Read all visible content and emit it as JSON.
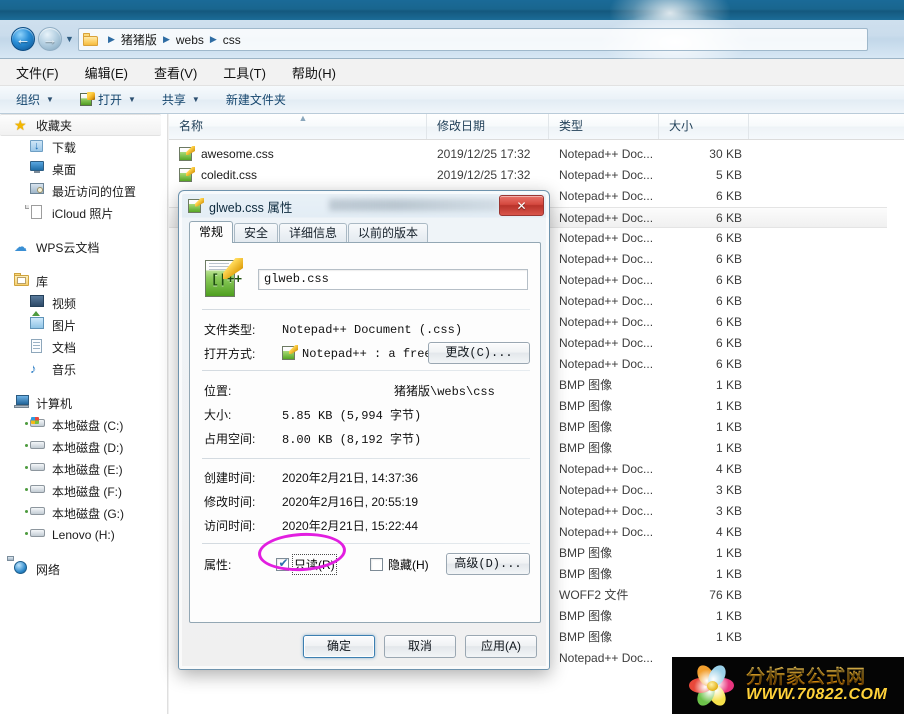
{
  "explorer": {
    "nav": {
      "back_icon": "back-arrow-icon",
      "forward_icon": "forward-arrow-icon",
      "history_icon": "chevron-down-icon",
      "breadcrumbs": [
        "猪猪版",
        "webs",
        "css"
      ],
      "separator": "▶"
    },
    "menu": [
      {
        "label": "文件(F)",
        "name": "menu-file"
      },
      {
        "label": "编辑(E)",
        "name": "menu-edit"
      },
      {
        "label": "查看(V)",
        "name": "menu-view"
      },
      {
        "label": "工具(T)",
        "name": "menu-tools"
      },
      {
        "label": "帮助(H)",
        "name": "menu-help"
      }
    ],
    "toolbar": [
      {
        "label": "组织",
        "caret": "▼",
        "name": "toolbar-organize"
      },
      {
        "label": "打开",
        "caret": "▼",
        "name": "toolbar-open"
      },
      {
        "label": "共享",
        "caret": "▼",
        "name": "toolbar-share"
      },
      {
        "label": "新建文件夹",
        "caret": "",
        "name": "toolbar-new-folder"
      }
    ],
    "sidebar": [
      {
        "label": "收藏夹",
        "icon": "star-icon",
        "level": 0,
        "selected": true
      },
      {
        "label": "下载",
        "icon": "downloads-icon",
        "level": 1,
        "selected": false
      },
      {
        "label": "桌面",
        "icon": "desktop-icon",
        "level": 1,
        "selected": false
      },
      {
        "label": "最近访问的位置",
        "icon": "recent-places-icon",
        "level": 1,
        "selected": false
      },
      {
        "label": "iCloud 照片",
        "icon": "document-icon",
        "level": 1,
        "selected": false
      },
      {
        "label": "WPS云文档",
        "icon": "cloud-icon",
        "level": 0,
        "selected": false
      },
      {
        "label": "库",
        "icon": "library-icon",
        "level": 0,
        "selected": false
      },
      {
        "label": "视频",
        "icon": "video-icon",
        "level": 1,
        "selected": false
      },
      {
        "label": "图片",
        "icon": "picture-icon",
        "level": 1,
        "selected": false
      },
      {
        "label": "文档",
        "icon": "text-document-icon",
        "level": 1,
        "selected": false
      },
      {
        "label": "音乐",
        "icon": "music-note-icon",
        "level": 1,
        "selected": false
      },
      {
        "label": "计算机",
        "icon": "computer-icon",
        "level": 0,
        "selected": false
      },
      {
        "label": "本地磁盘 (C:)",
        "icon": "system-drive-icon",
        "level": 1,
        "selected": false
      },
      {
        "label": "本地磁盘 (D:)",
        "icon": "drive-icon",
        "level": 1,
        "selected": false
      },
      {
        "label": "本地磁盘 (E:)",
        "icon": "drive-icon",
        "level": 1,
        "selected": false
      },
      {
        "label": "本地磁盘 (F:)",
        "icon": "drive-icon",
        "level": 1,
        "selected": false
      },
      {
        "label": "本地磁盘 (G:)",
        "icon": "drive-icon",
        "level": 1,
        "selected": false
      },
      {
        "label": "Lenovo (H:)",
        "icon": "drive-icon",
        "level": 1,
        "selected": false
      },
      {
        "label": "网络",
        "icon": "network-icon",
        "level": 0,
        "selected": false
      }
    ],
    "columns": [
      {
        "label": "名称",
        "name": "column-name"
      },
      {
        "label": "修改日期",
        "name": "column-date-modified"
      },
      {
        "label": "类型",
        "name": "column-type"
      },
      {
        "label": "大小",
        "name": "column-size"
      }
    ],
    "sort_indicator": "▲",
    "files": [
      {
        "name": "awesome.css",
        "date": "2019/12/25 17:32",
        "type": "Notepad++ Doc...",
        "size": "30 KB",
        "icon": "notepad-plus-file-icon",
        "selected": false
      },
      {
        "name": "coledit.css",
        "date": "2019/12/25 17:32",
        "type": "Notepad++ Doc...",
        "size": "5 KB",
        "icon": "notepad-plus-file-icon",
        "selected": false
      },
      {
        "name": "",
        "date": "",
        "type": "Notepad++ Doc...",
        "size": "6 KB",
        "icon": "notepad-plus-file-icon",
        "selected": false
      },
      {
        "name": "",
        "date": "",
        "type": "Notepad++ Doc...",
        "size": "6 KB",
        "icon": "notepad-plus-file-icon",
        "selected": true
      },
      {
        "name": "",
        "date": "",
        "type": "Notepad++ Doc...",
        "size": "6 KB",
        "icon": "notepad-plus-file-icon",
        "selected": false
      },
      {
        "name": "",
        "date": "",
        "type": "Notepad++ Doc...",
        "size": "6 KB",
        "icon": "notepad-plus-file-icon",
        "selected": false
      },
      {
        "name": "",
        "date": "",
        "type": "Notepad++ Doc...",
        "size": "6 KB",
        "icon": "notepad-plus-file-icon",
        "selected": false
      },
      {
        "name": "",
        "date": "",
        "type": "Notepad++ Doc...",
        "size": "6 KB",
        "icon": "notepad-plus-file-icon",
        "selected": false
      },
      {
        "name": "",
        "date": "",
        "type": "Notepad++ Doc...",
        "size": "6 KB",
        "icon": "notepad-plus-file-icon",
        "selected": false
      },
      {
        "name": "",
        "date": "",
        "type": "Notepad++ Doc...",
        "size": "6 KB",
        "icon": "notepad-plus-file-icon",
        "selected": false
      },
      {
        "name": "",
        "date": "",
        "type": "Notepad++ Doc...",
        "size": "6 KB",
        "icon": "notepad-plus-file-icon",
        "selected": false
      },
      {
        "name": "",
        "date": "",
        "type": "BMP 图像",
        "size": "1 KB",
        "icon": "bmp-image-icon",
        "selected": false
      },
      {
        "name": "",
        "date": "",
        "type": "BMP 图像",
        "size": "1 KB",
        "icon": "bmp-image-icon",
        "selected": false
      },
      {
        "name": "",
        "date": "",
        "type": "BMP 图像",
        "size": "1 KB",
        "icon": "bmp-image-icon",
        "selected": false
      },
      {
        "name": "",
        "date": "",
        "type": "BMP 图像",
        "size": "1 KB",
        "icon": "bmp-image-icon",
        "selected": false
      },
      {
        "name": "",
        "date": "",
        "type": "Notepad++ Doc...",
        "size": "4 KB",
        "icon": "notepad-plus-file-icon",
        "selected": false
      },
      {
        "name": "",
        "date": "",
        "type": "Notepad++ Doc...",
        "size": "3 KB",
        "icon": "notepad-plus-file-icon",
        "selected": false
      },
      {
        "name": "",
        "date": "",
        "type": "Notepad++ Doc...",
        "size": "3 KB",
        "icon": "notepad-plus-file-icon",
        "selected": false
      },
      {
        "name": "",
        "date": "",
        "type": "Notepad++ Doc...",
        "size": "4 KB",
        "icon": "notepad-plus-file-icon",
        "selected": false
      },
      {
        "name": "",
        "date": "",
        "type": "BMP 图像",
        "size": "1 KB",
        "icon": "bmp-image-icon",
        "selected": false
      },
      {
        "name": "",
        "date": "",
        "type": "BMP 图像",
        "size": "1 KB",
        "icon": "bmp-image-icon",
        "selected": false
      },
      {
        "name": "",
        "date": "",
        "type": "WOFF2 文件",
        "size": "76 KB",
        "icon": "woff2-file-icon",
        "selected": false
      },
      {
        "name": "",
        "date": "",
        "type": "BMP 图像",
        "size": "1 KB",
        "icon": "bmp-image-icon",
        "selected": false
      },
      {
        "name": "",
        "date": "",
        "type": "BMP 图像",
        "size": "1 KB",
        "icon": "bmp-image-icon",
        "selected": false
      },
      {
        "name": "",
        "date": "",
        "type": "Notepad++ Doc...",
        "size": "",
        "icon": "notepad-plus-file-icon",
        "selected": false
      }
    ]
  },
  "dialog": {
    "title": "glweb.css 属性",
    "title_icon": "notepad-plus-file-icon",
    "close_label": "✕",
    "tabs": [
      {
        "label": "常规",
        "name": "tab-general",
        "active": true
      },
      {
        "label": "安全",
        "name": "tab-security",
        "active": false
      },
      {
        "label": "详细信息",
        "name": "tab-details",
        "active": false
      },
      {
        "label": "以前的版本",
        "name": "tab-previous-versions",
        "active": false
      }
    ],
    "filename": "glweb.css",
    "rows": [
      {
        "label": "文件类型:",
        "value": "Notepad++ Document (.css)",
        "name": "file-type-row"
      },
      {
        "label": "打开方式:",
        "value": "Notepad++ : a free",
        "name": "opens-with-row"
      },
      {
        "label": "位置:",
        "value": "猪猪版\\webs\\css",
        "name": "location-row"
      },
      {
        "label": "大小:",
        "value": "5.85 KB (5,994 字节)",
        "name": "size-row"
      },
      {
        "label": "占用空间:",
        "value": "8.00 KB (8,192 字节)",
        "name": "size-on-disk-row"
      },
      {
        "label": "创建时间:",
        "value": "2020年2月21日, 14:37:36",
        "name": "created-row"
      },
      {
        "label": "修改时间:",
        "value": "2020年2月16日, 20:55:19",
        "name": "modified-row"
      },
      {
        "label": "访问时间:",
        "value": "2020年2月21日, 15:22:44",
        "name": "accessed-row"
      }
    ],
    "change_button": "更改(C)...",
    "attributes_label": "属性:",
    "readonly_label": "只读(R)",
    "readonly_checked": true,
    "hidden_label": "隐藏(H)",
    "hidden_checked": false,
    "advanced_button": "高级(D)...",
    "buttons": [
      {
        "label": "确定",
        "name": "ok-button",
        "default": true
      },
      {
        "label": "取消",
        "name": "cancel-button",
        "default": false
      },
      {
        "label": "应用(A)",
        "name": "apply-button",
        "default": false
      }
    ]
  },
  "annotation": {
    "shape": "ellipse",
    "color": "#e21ee0",
    "target": "只读(R)"
  },
  "watermark": {
    "title": "分析家公式网",
    "url": "WWW.70822.COM",
    "logo_icon": "flower-logo-icon"
  }
}
